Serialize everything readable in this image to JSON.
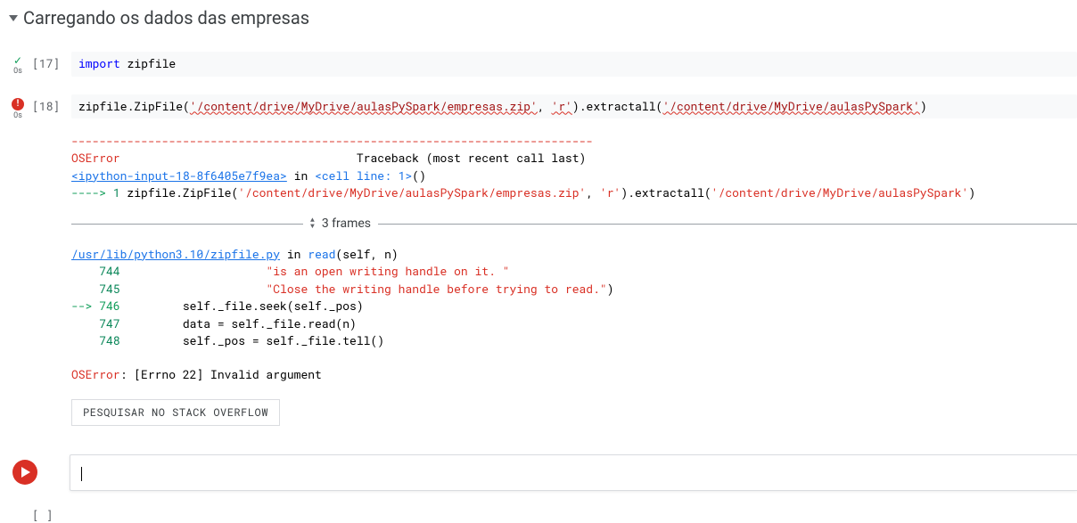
{
  "section": {
    "title": "Carregando os dados das empresas"
  },
  "cells": {
    "c17": {
      "gutter_time": "0s",
      "prompt": "[17]",
      "code_kw": "import",
      "code_plain": " zipfile"
    },
    "c18": {
      "gutter_time": "0s",
      "prompt": "[18]",
      "code_prefix": "zipfile.ZipFile(",
      "code_str1": "'/content/drive/MyDrive/aulasPySpark/empresas.zip'",
      "code_comma": ", ",
      "code_str2": "'r'",
      "code_mid": ").extractall(",
      "code_str3": "'/content/drive/MyDrive/aulasPySpark'",
      "code_close": ")"
    }
  },
  "traceback": {
    "dashes": "---------------------------------------------------------------------------",
    "err_name": "OSError",
    "tb_header_spaces": "                                  ",
    "tb_header": "Traceback (most recent call last)",
    "loc1_link": "<ipython-input-18-8f6405e7f9ea>",
    "loc1_in": " in ",
    "loc1_cell": "<cell line: 1>",
    "loc1_paren": "()",
    "arrow1": "----> ",
    "arrow1_num": "1",
    "line1_a": " zipfile.ZipFile(",
    "line1_s1": "'/content/drive/MyDrive/aulasPySpark/empresas.zip'",
    "line1_c": ", ",
    "line1_s2": "'r'",
    "line1_b": ").extractall(",
    "line1_s3": "'/content/drive/MyDrive/aulasPySpark'",
    "line1_close": ")",
    "frames_label": "3 frames",
    "loc2_link": "/usr/lib/python3.10/zipfile.py",
    "loc2_in": " in ",
    "loc2_fn": "read",
    "loc2_args": "(self, n)",
    "ln744": "    744",
    "txt744a": "                     ",
    "txt744s": "\"is an open writing handle on it. \"",
    "ln745": "    745",
    "txt745a": "                     ",
    "txt745s": "\"Close the writing handle before trying to read.\"",
    "txt745b": ")",
    "arrow746": "--> 746",
    "txt746": "         self._file.seek(self._pos)",
    "ln747": "    747",
    "txt747": "         data = self._file.read(n)",
    "ln748": "    748",
    "txt748": "         self._pos = self._file.tell()",
    "final_err": "OSError",
    "final_msg": ": [Errno 22] Invalid argument",
    "so_button": "PESQUISAR NO STACK OVERFLOW"
  },
  "empty_prompt": "[ ]"
}
